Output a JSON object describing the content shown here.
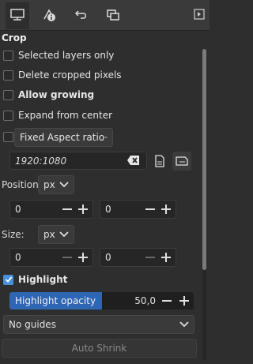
{
  "tabs": [
    {
      "icon": "tool-options-icon",
      "active": true
    },
    {
      "icon": "device-status-icon",
      "active": false
    },
    {
      "icon": "undo-history-icon",
      "active": false
    },
    {
      "icon": "images-icon",
      "active": false
    }
  ],
  "section_title": "Crop",
  "options": {
    "selected_layers_only": {
      "label": "Selected layers only",
      "checked": false
    },
    "delete_cropped_pixels": {
      "label": "Delete cropped pixels",
      "checked": false
    },
    "allow_growing": {
      "label": "Allow growing",
      "checked": false
    },
    "expand_from_center": {
      "label": "Expand from center",
      "checked": false
    },
    "fixed_aspect": {
      "label": "Fixed Aspect ratio",
      "checked": false
    }
  },
  "aspect_ratio_value": "1920:1080",
  "position": {
    "label": "Position:",
    "unit": "px",
    "x": "0",
    "y": "0"
  },
  "size": {
    "label": "Size:",
    "unit": "px",
    "w": "0",
    "h": "0"
  },
  "highlight": {
    "label": "Highlight",
    "checked": true
  },
  "highlight_opacity": {
    "label": "Highlight opacity",
    "value": "50,0",
    "fraction": 0.5
  },
  "guides": "No guides",
  "auto_shrink": "Auto Shrink"
}
